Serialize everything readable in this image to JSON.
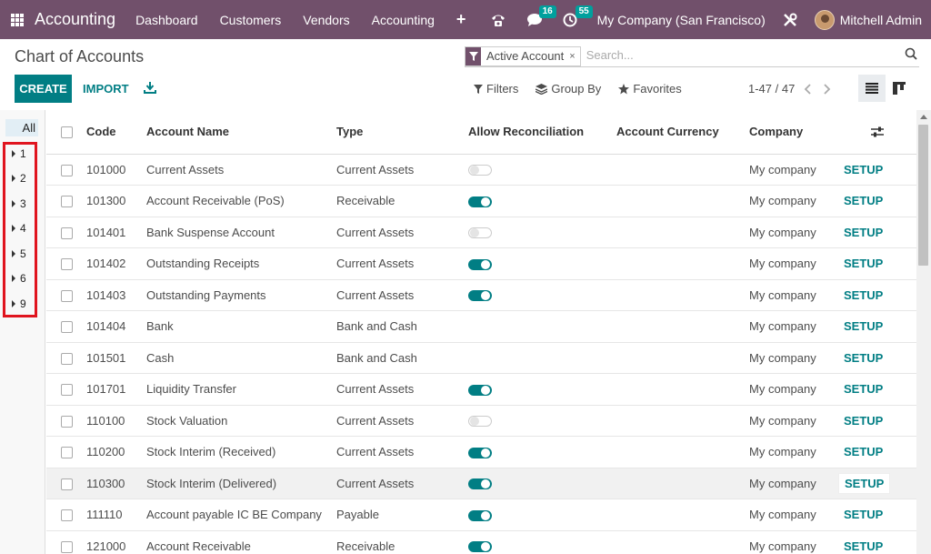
{
  "navbar": {
    "brand": "Accounting",
    "menu": [
      "Dashboard",
      "Customers",
      "Vendors",
      "Accounting"
    ],
    "plus": "+",
    "messages_count": "16",
    "activities_count": "55",
    "company": "My Company (San Francisco)",
    "user": "Mitchell Admin"
  },
  "control": {
    "title": "Chart of Accounts",
    "facet_label": "Active Account",
    "facet_close": "×",
    "search_placeholder": "Search...",
    "create_label": "CREATE",
    "import_label": "IMPORT",
    "filters_label": "Filters",
    "groupby_label": "Group By",
    "favorites_label": "Favorites",
    "pager": "1-47 / 47"
  },
  "groups": {
    "all_label": "All",
    "items": [
      "1",
      "2",
      "3",
      "4",
      "5",
      "6",
      "9"
    ]
  },
  "table": {
    "headers": [
      "Code",
      "Account Name",
      "Type",
      "Allow Reconciliation",
      "Account Currency",
      "Company"
    ],
    "setup_label": "SETUP",
    "rows": [
      {
        "code": "101000",
        "name": "Current Assets",
        "type": "Current Assets",
        "reconcile": "off",
        "currency": "",
        "company": "My company"
      },
      {
        "code": "101300",
        "name": "Account Receivable (PoS)",
        "type": "Receivable",
        "reconcile": "on",
        "currency": "",
        "company": "My company"
      },
      {
        "code": "101401",
        "name": "Bank Suspense Account",
        "type": "Current Assets",
        "reconcile": "off",
        "currency": "",
        "company": "My company"
      },
      {
        "code": "101402",
        "name": "Outstanding Receipts",
        "type": "Current Assets",
        "reconcile": "on",
        "currency": "",
        "company": "My company"
      },
      {
        "code": "101403",
        "name": "Outstanding Payments",
        "type": "Current Assets",
        "reconcile": "on",
        "currency": "",
        "company": "My company"
      },
      {
        "code": "101404",
        "name": "Bank",
        "type": "Bank and Cash",
        "reconcile": "none",
        "currency": "",
        "company": "My company"
      },
      {
        "code": "101501",
        "name": "Cash",
        "type": "Bank and Cash",
        "reconcile": "none",
        "currency": "",
        "company": "My company"
      },
      {
        "code": "101701",
        "name": "Liquidity Transfer",
        "type": "Current Assets",
        "reconcile": "on",
        "currency": "",
        "company": "My company"
      },
      {
        "code": "110100",
        "name": "Stock Valuation",
        "type": "Current Assets",
        "reconcile": "off",
        "currency": "",
        "company": "My company"
      },
      {
        "code": "110200",
        "name": "Stock Interim (Received)",
        "type": "Current Assets",
        "reconcile": "on",
        "currency": "",
        "company": "My company"
      },
      {
        "code": "110300",
        "name": "Stock Interim (Delivered)",
        "type": "Current Assets",
        "reconcile": "on",
        "currency": "",
        "company": "My company"
      },
      {
        "code": "111110",
        "name": "Account payable IC BE Company",
        "type": "Payable",
        "reconcile": "on",
        "currency": "",
        "company": "My company"
      },
      {
        "code": "121000",
        "name": "Account Receivable",
        "type": "Receivable",
        "reconcile": "on",
        "currency": "",
        "company": "My company"
      }
    ]
  },
  "colors": {
    "navbar": "#71506b",
    "accent": "#017e84",
    "highlight_box": "#e0141e"
  }
}
